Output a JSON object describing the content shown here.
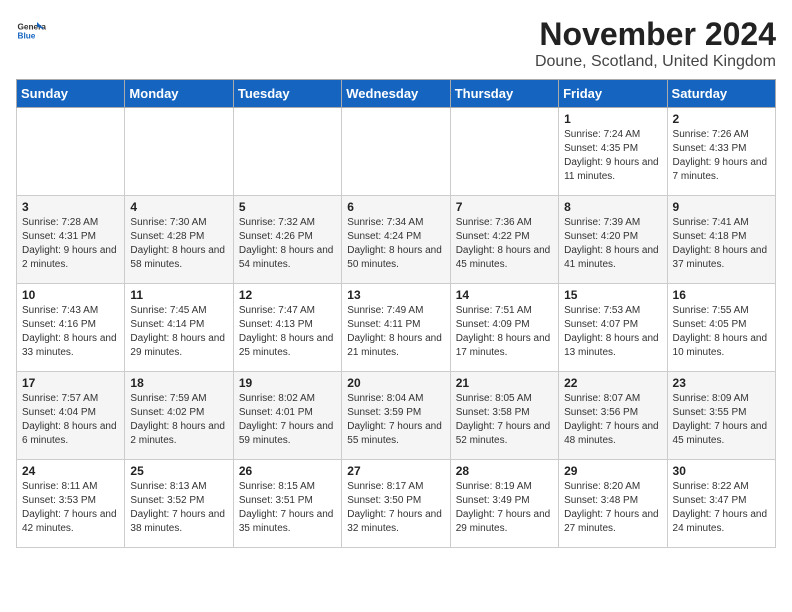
{
  "header": {
    "logo_general": "General",
    "logo_blue": "Blue",
    "month_title": "November 2024",
    "location": "Doune, Scotland, United Kingdom"
  },
  "days_of_week": [
    "Sunday",
    "Monday",
    "Tuesday",
    "Wednesday",
    "Thursday",
    "Friday",
    "Saturday"
  ],
  "weeks": [
    [
      {
        "day": "",
        "info": ""
      },
      {
        "day": "",
        "info": ""
      },
      {
        "day": "",
        "info": ""
      },
      {
        "day": "",
        "info": ""
      },
      {
        "day": "",
        "info": ""
      },
      {
        "day": "1",
        "info": "Sunrise: 7:24 AM\nSunset: 4:35 PM\nDaylight: 9 hours and 11 minutes."
      },
      {
        "day": "2",
        "info": "Sunrise: 7:26 AM\nSunset: 4:33 PM\nDaylight: 9 hours and 7 minutes."
      }
    ],
    [
      {
        "day": "3",
        "info": "Sunrise: 7:28 AM\nSunset: 4:31 PM\nDaylight: 9 hours and 2 minutes."
      },
      {
        "day": "4",
        "info": "Sunrise: 7:30 AM\nSunset: 4:28 PM\nDaylight: 8 hours and 58 minutes."
      },
      {
        "day": "5",
        "info": "Sunrise: 7:32 AM\nSunset: 4:26 PM\nDaylight: 8 hours and 54 minutes."
      },
      {
        "day": "6",
        "info": "Sunrise: 7:34 AM\nSunset: 4:24 PM\nDaylight: 8 hours and 50 minutes."
      },
      {
        "day": "7",
        "info": "Sunrise: 7:36 AM\nSunset: 4:22 PM\nDaylight: 8 hours and 45 minutes."
      },
      {
        "day": "8",
        "info": "Sunrise: 7:39 AM\nSunset: 4:20 PM\nDaylight: 8 hours and 41 minutes."
      },
      {
        "day": "9",
        "info": "Sunrise: 7:41 AM\nSunset: 4:18 PM\nDaylight: 8 hours and 37 minutes."
      }
    ],
    [
      {
        "day": "10",
        "info": "Sunrise: 7:43 AM\nSunset: 4:16 PM\nDaylight: 8 hours and 33 minutes."
      },
      {
        "day": "11",
        "info": "Sunrise: 7:45 AM\nSunset: 4:14 PM\nDaylight: 8 hours and 29 minutes."
      },
      {
        "day": "12",
        "info": "Sunrise: 7:47 AM\nSunset: 4:13 PM\nDaylight: 8 hours and 25 minutes."
      },
      {
        "day": "13",
        "info": "Sunrise: 7:49 AM\nSunset: 4:11 PM\nDaylight: 8 hours and 21 minutes."
      },
      {
        "day": "14",
        "info": "Sunrise: 7:51 AM\nSunset: 4:09 PM\nDaylight: 8 hours and 17 minutes."
      },
      {
        "day": "15",
        "info": "Sunrise: 7:53 AM\nSunset: 4:07 PM\nDaylight: 8 hours and 13 minutes."
      },
      {
        "day": "16",
        "info": "Sunrise: 7:55 AM\nSunset: 4:05 PM\nDaylight: 8 hours and 10 minutes."
      }
    ],
    [
      {
        "day": "17",
        "info": "Sunrise: 7:57 AM\nSunset: 4:04 PM\nDaylight: 8 hours and 6 minutes."
      },
      {
        "day": "18",
        "info": "Sunrise: 7:59 AM\nSunset: 4:02 PM\nDaylight: 8 hours and 2 minutes."
      },
      {
        "day": "19",
        "info": "Sunrise: 8:02 AM\nSunset: 4:01 PM\nDaylight: 7 hours and 59 minutes."
      },
      {
        "day": "20",
        "info": "Sunrise: 8:04 AM\nSunset: 3:59 PM\nDaylight: 7 hours and 55 minutes."
      },
      {
        "day": "21",
        "info": "Sunrise: 8:05 AM\nSunset: 3:58 PM\nDaylight: 7 hours and 52 minutes."
      },
      {
        "day": "22",
        "info": "Sunrise: 8:07 AM\nSunset: 3:56 PM\nDaylight: 7 hours and 48 minutes."
      },
      {
        "day": "23",
        "info": "Sunrise: 8:09 AM\nSunset: 3:55 PM\nDaylight: 7 hours and 45 minutes."
      }
    ],
    [
      {
        "day": "24",
        "info": "Sunrise: 8:11 AM\nSunset: 3:53 PM\nDaylight: 7 hours and 42 minutes."
      },
      {
        "day": "25",
        "info": "Sunrise: 8:13 AM\nSunset: 3:52 PM\nDaylight: 7 hours and 38 minutes."
      },
      {
        "day": "26",
        "info": "Sunrise: 8:15 AM\nSunset: 3:51 PM\nDaylight: 7 hours and 35 minutes."
      },
      {
        "day": "27",
        "info": "Sunrise: 8:17 AM\nSunset: 3:50 PM\nDaylight: 7 hours and 32 minutes."
      },
      {
        "day": "28",
        "info": "Sunrise: 8:19 AM\nSunset: 3:49 PM\nDaylight: 7 hours and 29 minutes."
      },
      {
        "day": "29",
        "info": "Sunrise: 8:20 AM\nSunset: 3:48 PM\nDaylight: 7 hours and 27 minutes."
      },
      {
        "day": "30",
        "info": "Sunrise: 8:22 AM\nSunset: 3:47 PM\nDaylight: 7 hours and 24 minutes."
      }
    ]
  ]
}
